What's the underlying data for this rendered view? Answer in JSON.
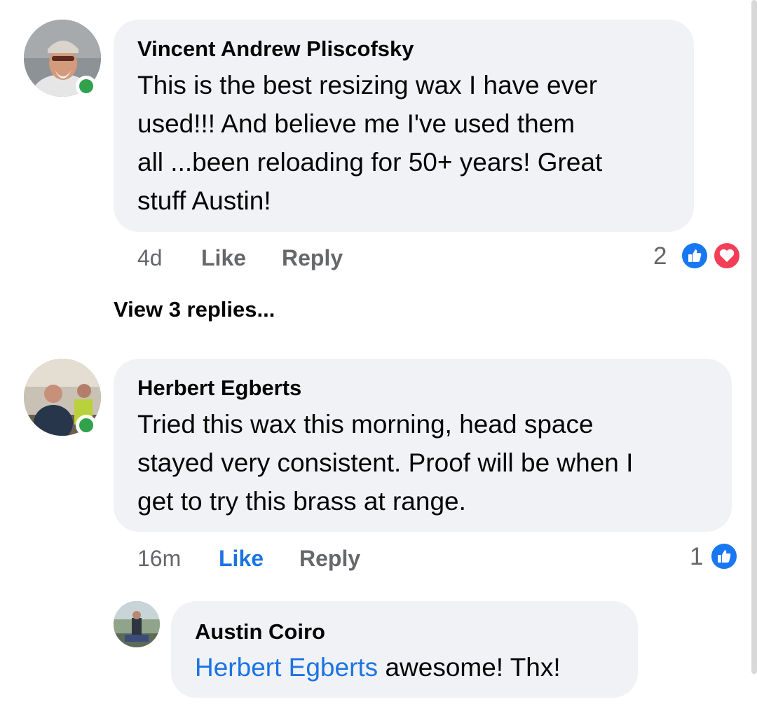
{
  "comments": [
    {
      "author": "Vincent Andrew Pliscofsky",
      "lines": [
        "This is the best resizing wax I have ever",
        "used!!! And believe me I've used them",
        "all ...been reloading for 50+ years! Great",
        "stuff Austin!"
      ],
      "time": "4d",
      "like_label": "Like",
      "reply_label": "Reply",
      "reaction_count": "2",
      "reactions": [
        "like-icon",
        "love-icon"
      ],
      "online": true
    },
    {
      "author": "Herbert Egberts",
      "lines": [
        "Tried this wax this morning, head space",
        "stayed very consistent. Proof will be when I",
        "get to try this brass at range."
      ],
      "time": "16m",
      "like_label": "Like",
      "reply_label": "Reply",
      "reaction_count": "1",
      "reactions": [
        "like-icon"
      ],
      "online": true,
      "liked_by_viewer": true
    }
  ],
  "view_replies": "View 3 replies...",
  "reply": {
    "author": "Austin Coiro",
    "mention": "Herbert Egberts",
    "text": " awesome! Thx!"
  },
  "colors": {
    "bubble": "#f0f2f5",
    "link_blue": "#1b74e4",
    "meta_gray": "#65676b",
    "online_green": "#31a24c",
    "love_red": "#f33e58"
  }
}
